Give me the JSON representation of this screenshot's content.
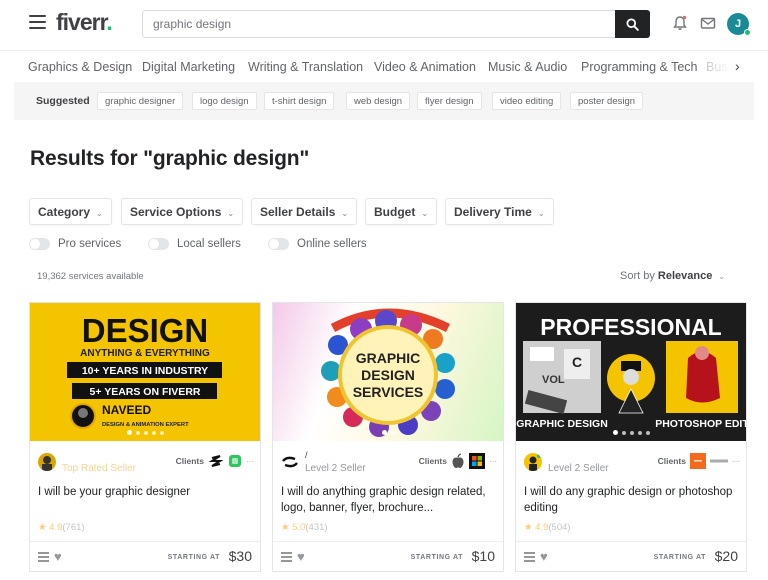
{
  "header": {
    "logo": "fiverr",
    "logo_dot": ".",
    "search_value": "graphic design",
    "avatar_initial": "J",
    "colors": {
      "brand_green": "#1dbf73",
      "avatar_bg": "#1a8a95",
      "search_button": "#222325"
    }
  },
  "categories": {
    "items": [
      "Graphics & Design",
      "Digital Marketing",
      "Writing & Translation",
      "Video & Animation",
      "Music & Audio",
      "Programming & Tech",
      "Busi"
    ],
    "next_icon": "chevron-right-icon"
  },
  "suggested": {
    "label": "Suggested",
    "tags": [
      "graphic designer",
      "logo design",
      "t-shirt design",
      "web design",
      "flyer design",
      "video editing",
      "poster design"
    ]
  },
  "results": {
    "title": "Results for \"graphic design\"",
    "filters": [
      "Category",
      "Service Options",
      "Seller Details",
      "Budget",
      "Delivery Time"
    ],
    "toggles": [
      "Pro services",
      "Local sellers",
      "Online sellers"
    ],
    "count": "19,362 services available",
    "sort_label": "Sort by",
    "sort_value": "Relevance"
  },
  "gigs": [
    {
      "thumb": {
        "headline": "DESIGN",
        "sub": "ANYTHING & EVERYTHING",
        "line1": "10+ YEARS IN INDUSTRY",
        "line2": "5+ YEARS ON FIVERR",
        "name": "NAVEED",
        "role": "DESIGN & ANIMATION EXPERT",
        "bg": "#f5c400"
      },
      "seller_level": "Top Rated Seller",
      "clients_label": "Clients",
      "title": "I will be your graphic designer",
      "rating": "4.9",
      "reviews": "(761)",
      "starting_at": "STARTING AT",
      "price": "$30"
    },
    {
      "thumb": {
        "line1": "GRAPHIC",
        "line2": "DESIGN",
        "line3": "SERVICES"
      },
      "seller_name": "/",
      "seller_level": "Level 2 Seller",
      "clients_label": "Clients",
      "title": "I will do anything graphic design related, logo, banner, flyer, brochure...",
      "rating": "5.0",
      "reviews": "(431)",
      "starting_at": "STARTING AT",
      "price": "$10"
    },
    {
      "thumb": {
        "headline": "PROFESSIONAL",
        "left_caption": "GRAPHIC DESIGN",
        "right_caption": "PHOTOSHOP EDIT"
      },
      "seller_level": "Level 2 Seller",
      "clients_label": "Clients",
      "title": "I will do any graphic design or photoshop editing",
      "rating": "4.9",
      "reviews": "(504)",
      "starting_at": "STARTING AT",
      "price": "$20"
    }
  ]
}
